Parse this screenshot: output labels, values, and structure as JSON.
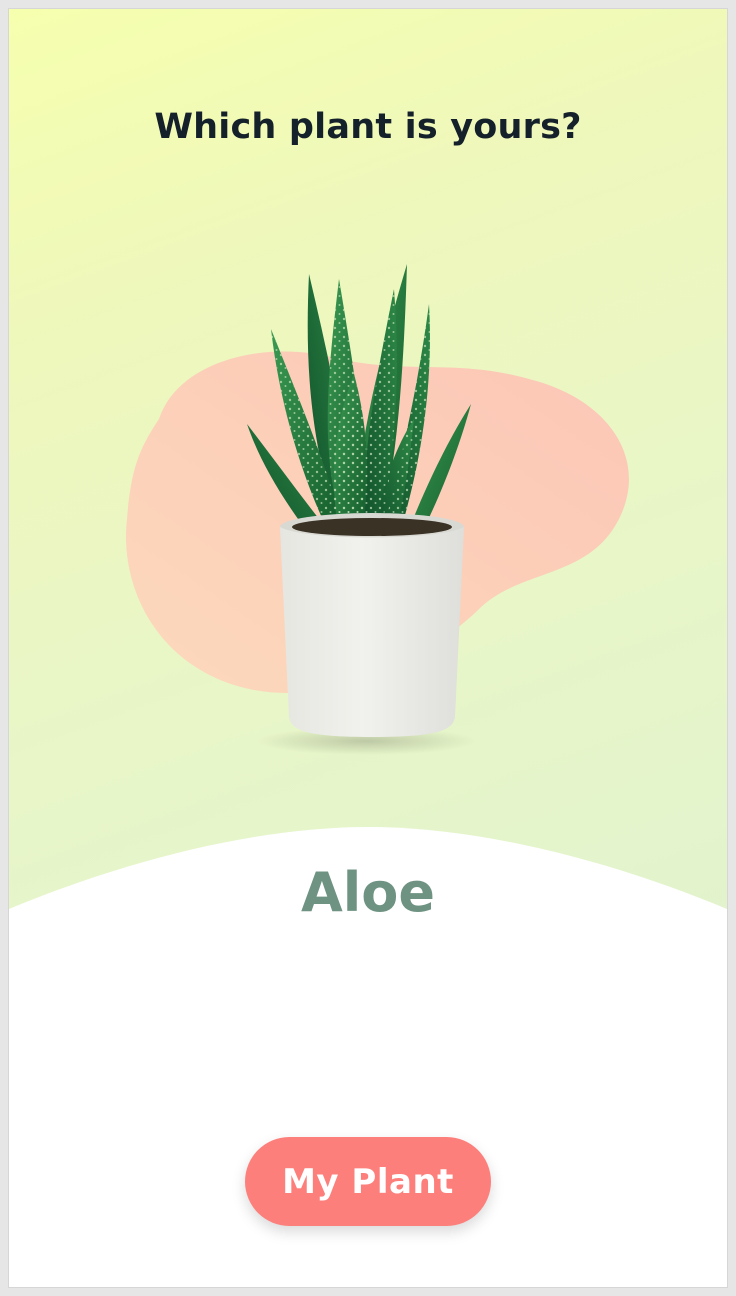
{
  "header": {
    "title": "Which plant is yours?"
  },
  "plant": {
    "name": "Aloe",
    "image_icon": "potted-aloe-plant"
  },
  "actions": {
    "primary_label": "My Plant"
  },
  "colors": {
    "background_top": "#f6ffae",
    "background_bottom": "#e2f3cd",
    "blob": "#fcc6b4",
    "plant_name": "#6f9382",
    "button": "#fd7f7b",
    "button_text": "#ffffff",
    "title": "#14202a"
  }
}
